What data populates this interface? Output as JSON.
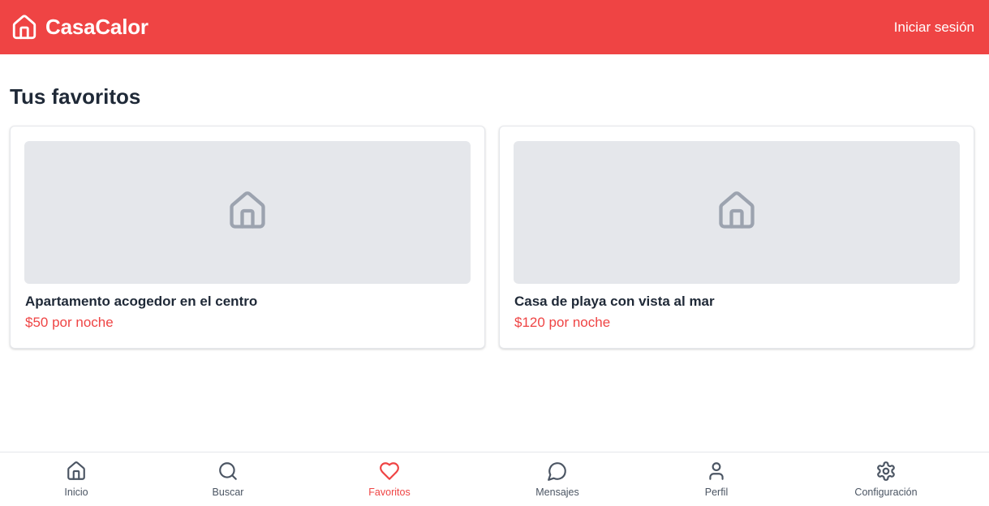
{
  "header": {
    "brand_icon": "home-icon",
    "brand_name": "CasaCalor",
    "login_label": "Iniciar sesión"
  },
  "main": {
    "title": "Tus favoritos",
    "favorites": [
      {
        "title": "Apartamento acogedor en el centro",
        "price": "$50 por noche",
        "image_icon": "home-icon"
      },
      {
        "title": "Casa de playa con vista al mar",
        "price": "$120 por noche",
        "image_icon": "home-icon"
      }
    ]
  },
  "bottom_nav": {
    "active": "Favoritos",
    "items": [
      {
        "label": "Inicio",
        "icon": "home-icon"
      },
      {
        "label": "Buscar",
        "icon": "search-icon"
      },
      {
        "label": "Favoritos",
        "icon": "heart-icon"
      },
      {
        "label": "Mensajes",
        "icon": "message-icon"
      },
      {
        "label": "Perfil",
        "icon": "user-icon"
      },
      {
        "label": "Configuración",
        "icon": "gear-icon"
      }
    ]
  },
  "colors": {
    "brand": "#ef4444",
    "text": "#1f2937",
    "muted": "#4b5563",
    "placeholder": "#e5e7eb",
    "placeholder_icon": "#9ca3af"
  }
}
